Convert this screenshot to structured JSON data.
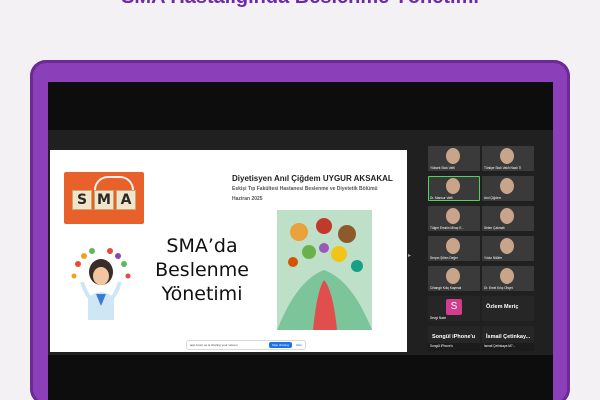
{
  "banner": {
    "title": "SMA Hastalığında Beslenme Yönetimi"
  },
  "slide": {
    "logo_letters": [
      "S",
      "M",
      "A"
    ],
    "presenter": "Diyetisyen Anıl Çiğdem UYGUR AKSAKAL",
    "department": "Eskişi Tıp Fakültesi Hastanesi Beslenme ve Diyetetik Bölümü",
    "date": "Haziran 2025",
    "title_line1": "SMA’da",
    "title_line2": "Beslenme",
    "title_line3": "Yönetimi"
  },
  "share_bar": {
    "text": "app.zoom.us is sharing your screen.",
    "stop_label": "Stop sharing",
    "hide_label": "Hide"
  },
  "participants": [
    {
      "label": "Yüksek Stok Vafti"
    },
    {
      "label": "Türkiye Stok Vakfı Nazlı Ti"
    },
    {
      "label": "Dr. Mansur Vafti"
    },
    {
      "label": "Anıl Çiğdem"
    },
    {
      "label": "Tülger Ersinin Miraç E..."
    },
    {
      "label": "Selen Çakmak"
    },
    {
      "label": "Serpın Şölen Değer"
    },
    {
      "label": "Yıldız Nilüfer"
    },
    {
      "label": "Cihangir Kılıç Kaymak"
    },
    {
      "label": "Dr. Emel Kılıç Ohçet"
    },
    {
      "label": "Sevgi Naim",
      "avatar_letter": "S"
    },
    {
      "label": "Özlem Meriç",
      "is_name_tile": true
    },
    {
      "label": "Songül iPhone'u",
      "is_name_tile": true,
      "sub": "Songül iPhone'u"
    },
    {
      "label": "İsmail Çetinkay...",
      "is_name_tile": true,
      "sub": "İsmail Çetinkaya M7..."
    }
  ],
  "colors": {
    "laptop": "#8b3fb8",
    "accent_logo": "#e8602a",
    "active_speaker": "#4fd35a",
    "avatar": "#d43c8e"
  }
}
